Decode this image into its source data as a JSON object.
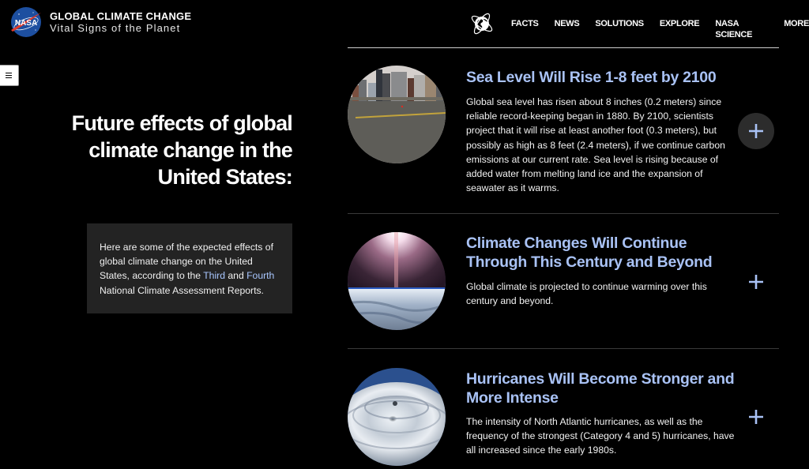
{
  "header": {
    "logo_label": "NASA",
    "title": "GLOBAL CLIMATE CHANGE",
    "subtitle": "Vital Signs of the Planet",
    "nav": [
      {
        "label": "FACTS"
      },
      {
        "label": "NEWS"
      },
      {
        "label": "SOLUTIONS"
      },
      {
        "label": "EXPLORE"
      },
      {
        "label": "NASA SCIENCE"
      },
      {
        "label": "MORE"
      }
    ]
  },
  "sidebar": {
    "toggle_icon": "hamburger-menu-icon"
  },
  "main": {
    "title": "Future effects of global climate change in the United States:",
    "intro": {
      "text_before": "Here are some of the expected effects of global climate change on the United States, according to the ",
      "link1": "Third",
      "text_mid": " and ",
      "link2": "Fourth",
      "text_after": " National Climate Assessment Reports."
    },
    "effects": [
      {
        "title": "Sea Level Will Rise 1-8 feet by 2100",
        "body": "Global sea level has risen about 8 inches (0.2 meters) since reliable record-keeping began in 1880. By 2100, scientists project that it will rise at least another foot (0.3 meters), but possibly as high as 8 feet (2.4 meters), if we continue carbon emissions at our current rate. Sea level is rising because of added water from melting land ice and the expansion of seawater as it warms.",
        "image": "city-skyline-waterfront",
        "expand_icon": "plus-icon"
      },
      {
        "title": "Climate Changes Will Continue Through This Century and Beyond",
        "body": "Global climate is projected to continue warming over this century and beyond.",
        "image": "earth-from-space-sunrise",
        "expand_icon": "plus-icon"
      },
      {
        "title": "Hurricanes Will Become Stronger and More Intense",
        "body": "The intensity of North Atlantic hurricanes, as well as the frequency of the strongest (Category 4 and 5) hurricanes, have all increased since the early 1980s.",
        "image": "hurricane-satellite",
        "expand_icon": "plus-icon"
      }
    ]
  },
  "colors": {
    "background": "#000000",
    "heading_accent": "#a9c2f5",
    "link": "#a9c7ff",
    "intro_box": "#232323"
  }
}
